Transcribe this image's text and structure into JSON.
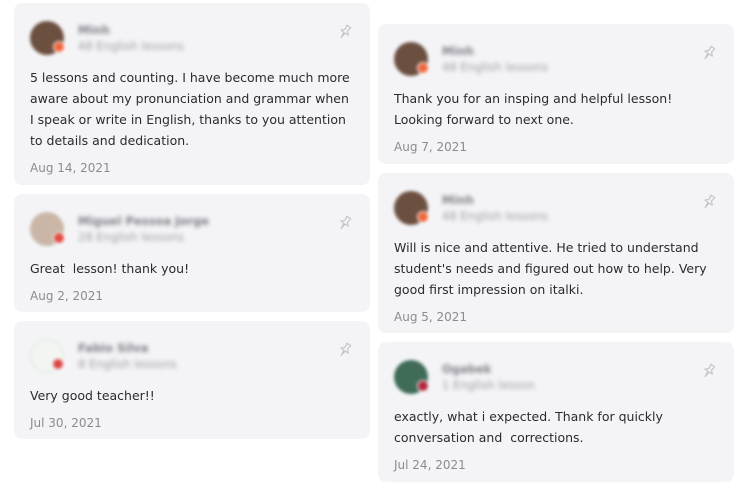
{
  "reviews_left": [
    {
      "name": "Minh",
      "lessons": "48 English lessons",
      "text": "5 lessons and counting. I have become much more aware about my pronunciation and grammar when I speak or write in English, thanks to you attention to details and dedication.",
      "date": "Aug 14, 2021",
      "avatar_color": "#6b4f3f",
      "flag_color": "#f0673f"
    },
    {
      "name": "Miguel Pessoa Jorge",
      "lessons": "28 English lessons",
      "text": "Great  lesson! thank you!",
      "date": "Aug 2, 2021",
      "avatar_color": "#c9b6a6",
      "flag_color": "#e04a3c"
    },
    {
      "name": "Fabio Silva",
      "lessons": "8 English lessons",
      "text": "Very good teacher!!",
      "date": "Jul 30, 2021",
      "avatar_color": "#f2f5f2",
      "flag_color": "#d94747"
    }
  ],
  "reviews_right": [
    {
      "name": "Minh",
      "lessons": "48 English lessons",
      "text": "Thank you for an insping and helpful lesson! Looking forward to next one.",
      "date": "Aug 7, 2021",
      "avatar_color": "#6b4f3f",
      "flag_color": "#f0673f"
    },
    {
      "name": "Minh",
      "lessons": "48 English lessons",
      "text": "Will is nice and attentive. He tried to understand student's needs and figured out how to help. Very good first impression on italki.",
      "date": "Aug 5, 2021",
      "avatar_color": "#6b4f3f",
      "flag_color": "#f0673f"
    },
    {
      "name": "Ogabek",
      "lessons": "1 English lesson",
      "text": "exactly, what i expected. Thank for quickly conversation and  corrections.",
      "date": "Jul 24, 2021",
      "avatar_color": "#3f6b57",
      "flag_color": "#b3263c"
    }
  ],
  "icons": {
    "pin": "pin-icon"
  }
}
